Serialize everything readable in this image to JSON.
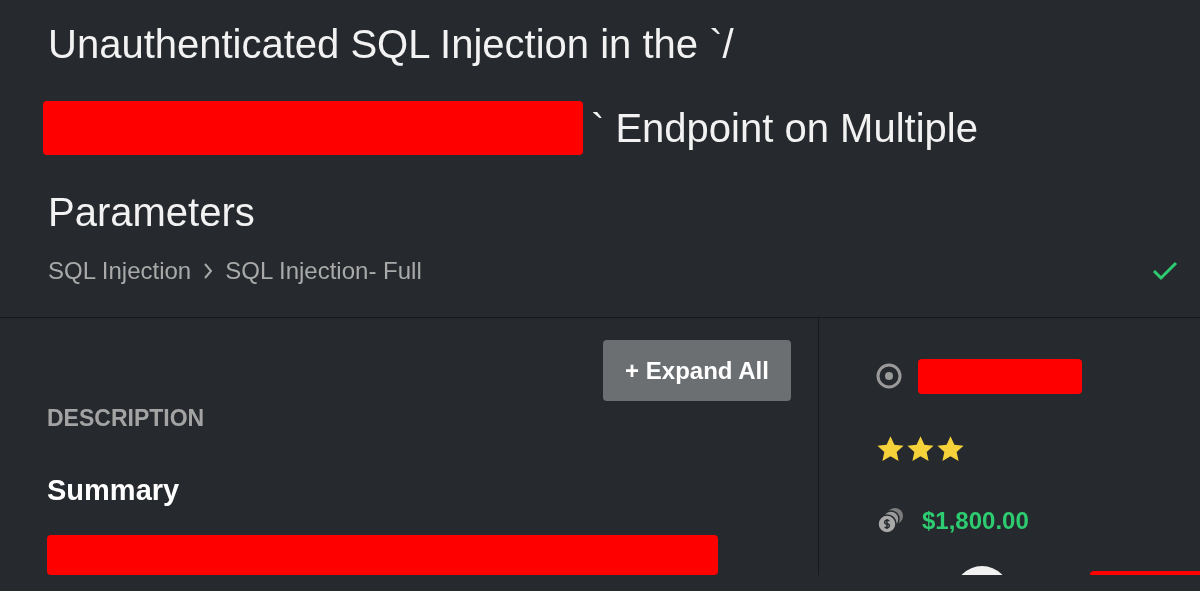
{
  "title_lines": [
    "Unauthenticated SQL Injection in the `/",
    "` Endpoint on Multiple",
    "Parameters"
  ],
  "breadcrumb": [
    {
      "label": "SQL Injection"
    },
    {
      "label": "SQL Injection- Full"
    }
  ],
  "verified": true,
  "expand_button": "+ Expand All",
  "section_label": "DESCRIPTION",
  "summary_heading": "Summary",
  "sidebar": {
    "stars": 3,
    "bounty": "$1,800.00"
  }
}
